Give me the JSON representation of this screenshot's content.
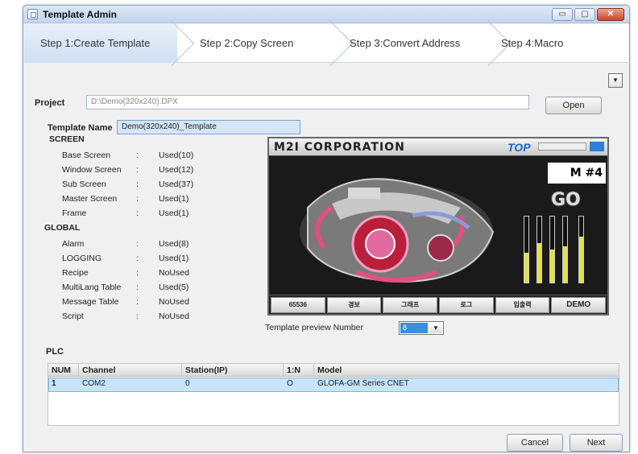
{
  "window": {
    "title": "Template Admin",
    "minimize": "▭",
    "maximize": "▢",
    "close": "✕"
  },
  "steps": [
    {
      "label": "Step 1:Create Template",
      "active": true
    },
    {
      "label": "Step 2:Copy Screen",
      "active": false
    },
    {
      "label": "Step 3:Convert Address",
      "active": false
    },
    {
      "label": "Step 4:Macro",
      "active": false
    }
  ],
  "toolbar": {
    "collapse_icon": "▼"
  },
  "project": {
    "label": "Project",
    "path": "D:\\Demo(320x240).DPX",
    "open_label": "Open"
  },
  "template": {
    "name_label": "Template Name",
    "name_value": "Demo(320x240)_Template"
  },
  "screen": {
    "section": "SCREEN",
    "rows": [
      {
        "name": "Base Screen",
        "sep": ":",
        "value": "Used(10)"
      },
      {
        "name": "Window Screen",
        "sep": ":",
        "value": "Used(12)"
      },
      {
        "name": "Sub Screen",
        "sep": ":",
        "value": "Used(37)"
      },
      {
        "name": "Master Screen",
        "sep": ":",
        "value": "Used(1)"
      },
      {
        "name": "Frame",
        "sep": ":",
        "value": "Used(1)"
      }
    ]
  },
  "global": {
    "section": "GLOBAL",
    "rows": [
      {
        "name": "Alarm",
        "sep": ":",
        "value": "Used(8)"
      },
      {
        "name": "LOGGING",
        "sep": ":",
        "value": "Used(1)"
      },
      {
        "name": "Recipe",
        "sep": ":",
        "value": "NoUsed"
      },
      {
        "name": "MultiLang Table",
        "sep": ":",
        "value": "Used(5)"
      },
      {
        "name": "Message Table",
        "sep": ":",
        "value": "NoUsed"
      },
      {
        "name": "Script",
        "sep": ":",
        "value": "NoUsed"
      }
    ]
  },
  "preview": {
    "corp": "M2I  CORPORATION",
    "top_logo": "TOP",
    "mbox": "M #4",
    "go": "GO",
    "gauges": [
      0.45,
      0.6,
      0.5,
      0.55,
      0.7
    ],
    "buttons": [
      "65536",
      "경보",
      "그래프",
      "로그",
      "입출력",
      "DEMO"
    ],
    "number_label": "Template preview Number",
    "number_value": "8",
    "number_dropdown": "▼"
  },
  "plc": {
    "section": "PLC",
    "columns": [
      "NUM",
      "Channel",
      "Station(IP)",
      "1:N",
      "Model"
    ],
    "rows": [
      {
        "num": "1",
        "channel": "COM2",
        "station": "0",
        "n": "O",
        "model": "GLOFA-GM Series CNET"
      }
    ]
  },
  "footer": {
    "cancel_label": "Cancel",
    "next_label": "Next"
  }
}
